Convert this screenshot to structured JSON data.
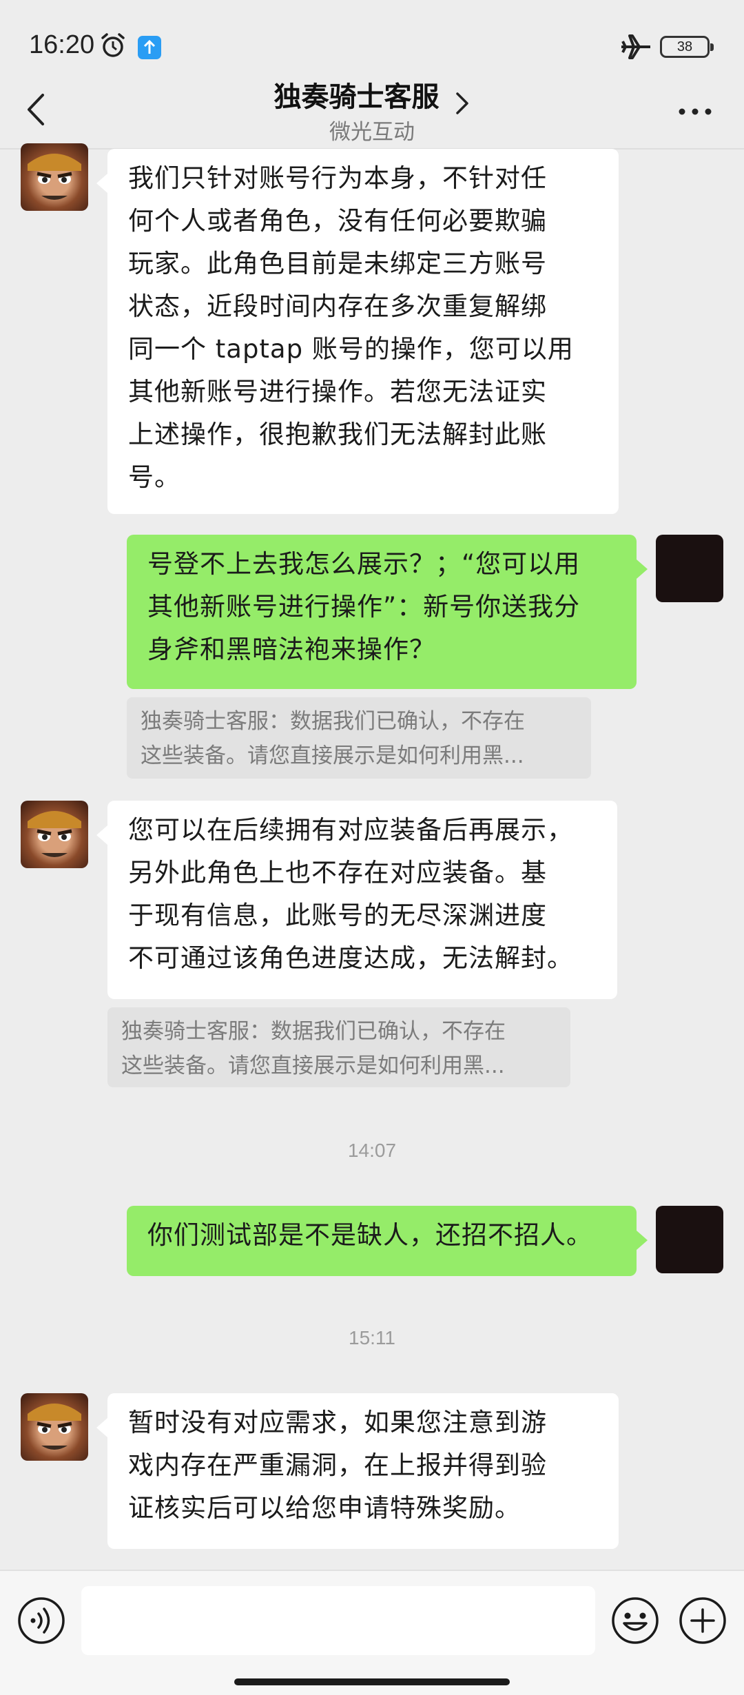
{
  "status_bar": {
    "time": "16:20",
    "battery_level": "38",
    "icons": [
      "alarm-icon",
      "upload-icon",
      "airplane-mode-icon",
      "battery-icon"
    ]
  },
  "header": {
    "title": "独奏骑士客服",
    "subtitle": "微光互动",
    "icons": [
      "back-icon",
      "chevron-right-icon",
      "more-icon"
    ]
  },
  "messages": {
    "m1": {
      "lines": [
        "我们只针对账号行为本身，不针对任",
        "何个人或者角色，没有任何必要欺骗",
        "玩家。此角色目前是未绑定三方账号",
        "状态，近段时间内存在多次重复解绑",
        "同一个 taptap 账号的操作，您可以用",
        "其他新账号进行操作。若您无法证实",
        "上述操作，很抱歉我们无法解封此账",
        "号。"
      ]
    },
    "m2": {
      "lines": [
        "号登不上去我怎么展示？；“您可以用",
        "其他新账号进行操作”：新号你送我分",
        "身斧和黑暗法袍来操作？"
      ],
      "quote": [
        "独奏骑士客服：数据我们已确认，不存在",
        "这些装备。请您直接展示是如何利用黑..."
      ]
    },
    "m3": {
      "lines": [
        "您可以在后续拥有对应装备后再展示，",
        "另外此角色上也不存在对应装备。基",
        "于现有信息，此账号的无尽深渊进度",
        "不可通过该角色进度达成，无法解封。"
      ],
      "quote": [
        "独奏骑士客服：数据我们已确认，不存在",
        "这些装备。请您直接展示是如何利用黑..."
      ]
    },
    "ts1": "14:07",
    "m4": {
      "lines": [
        "你们测试部是不是缺人，还招不招人。"
      ]
    },
    "ts2": "15:11",
    "m5": {
      "lines": [
        "暂时没有对应需求，如果您注意到游",
        "戏内存在严重漏洞，在上报并得到验",
        "证核实后可以给您申请特殊奖励。"
      ]
    }
  },
  "input_bar": {
    "text_value": "",
    "icons": [
      "voice-icon",
      "emoji-icon",
      "plus-icon"
    ]
  },
  "colors": {
    "background": "#ededed",
    "incoming_bubble": "#ffffff",
    "outgoing_bubble": "#95ec69",
    "quote_bg": "#e2e2e2"
  }
}
